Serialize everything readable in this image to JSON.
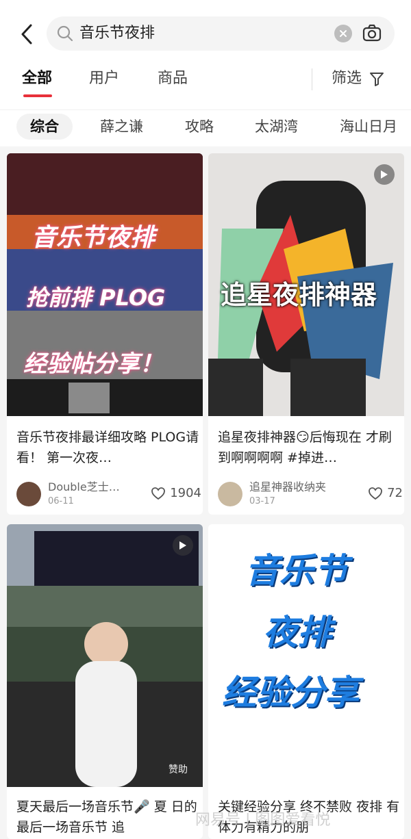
{
  "search": {
    "query": "音乐节夜排"
  },
  "tabs": [
    {
      "label": "全部",
      "active": true
    },
    {
      "label": "用户",
      "active": false
    },
    {
      "label": "商品",
      "active": false
    }
  ],
  "filter": {
    "label": "筛选"
  },
  "chips": [
    {
      "label": "综合",
      "active": true
    },
    {
      "label": "薛之谦",
      "active": false
    },
    {
      "label": "攻略",
      "active": false
    },
    {
      "label": "太湖湾",
      "active": false
    },
    {
      "label": "海山日月",
      "active": false
    }
  ],
  "cards": [
    {
      "overlay": [
        "音乐节夜排",
        "抢前排 PLOG",
        "经验帖分享！"
      ],
      "title": "音乐节夜排最详细攻略 PLOG请看！ 第一次夜…",
      "author": "Double芝士…",
      "date": "06-11",
      "likes": "1904",
      "has_video": false
    },
    {
      "overlay": [
        "追星夜排神器"
      ],
      "title": "追星夜排神器😏后悔现在 才刷到啊啊啊啊 #掉进…",
      "author": "追星神器收纳夹",
      "date": "03-17",
      "likes": "72",
      "has_video": true
    },
    {
      "overlay": [],
      "badge": "赞助",
      "title": "夏天最后一场音乐节🎤 夏 日的最后一场音乐节 追",
      "has_video": true
    },
    {
      "overlay": [
        "音乐节",
        "夜排",
        "经验分享"
      ],
      "title": "关键经验分享 终不禁败 夜排 有体力有精力的朋"
    }
  ],
  "watermark": "网易号 | 图图爱看悦",
  "colors": {
    "accent": "#e8303a",
    "overlay_pink": "#f05a8a",
    "overlay_blue": "#1e7de0"
  }
}
